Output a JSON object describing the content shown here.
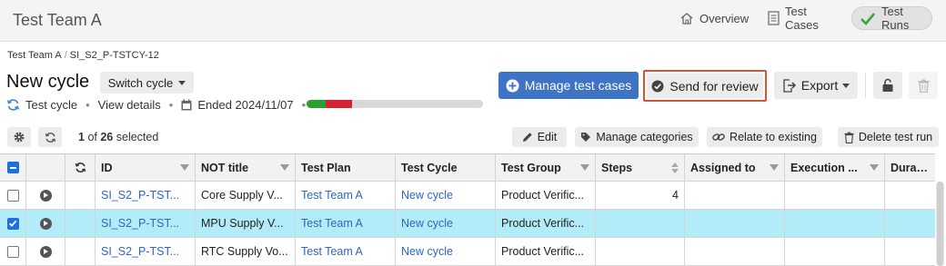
{
  "header": {
    "team_title": "Test Team A",
    "nav": {
      "overview": "Overview",
      "test_cases": "Test Cases",
      "test_runs": "Test Runs"
    }
  },
  "breadcrumb": {
    "team": "Test Team A",
    "separator": "/",
    "cycle_id": "SI_S2_P-TSTCY-12"
  },
  "title": {
    "name": "New cycle",
    "switch_label": "Switch cycle"
  },
  "subline": {
    "type": "Test cycle",
    "view_details": "View details",
    "ended": "Ended 2024/11/07"
  },
  "progress": {
    "segments": [
      {
        "color": "#2ca02c",
        "fraction": 0.11
      },
      {
        "color": "#d62333",
        "fraction": 0.15
      },
      {
        "color": "#d8d8d8",
        "fraction": 0.74
      }
    ]
  },
  "actions": {
    "manage": "Manage test cases",
    "review": "Send for review",
    "export": "Export"
  },
  "toolbar": {
    "selected_count": "1",
    "selected_of": "of",
    "selected_total": "26",
    "selected_suffix": "selected",
    "edit": "Edit",
    "categories": "Manage categories",
    "relate": "Relate to existing",
    "delete": "Delete test run"
  },
  "table": {
    "columns": [
      "ID",
      "NOT title",
      "Test Plan",
      "Test Cycle",
      "Test Group",
      "Steps",
      "Assigned to",
      "Execution ...",
      "Duration"
    ],
    "rows": [
      {
        "id": "SI_S2_P-TST...",
        "title": "Core Supply V...",
        "plan": "Test Team A",
        "cycle": "New cycle",
        "group": "Product Verific...",
        "steps": "4",
        "assigned": "",
        "execution": "",
        "duration": "",
        "selected": false
      },
      {
        "id": "SI_S2_P-TST...",
        "title": "MPU Supply V...",
        "plan": "Test Team A",
        "cycle": "New cycle",
        "group": "Product Verific...",
        "steps": "",
        "assigned": "",
        "execution": "",
        "duration": "",
        "selected": true
      },
      {
        "id": "SI_S2_P-TST...",
        "title": "RTC Supply Vo...",
        "plan": "Test Team A",
        "cycle": "New cycle",
        "group": "Product Verific...",
        "steps": "",
        "assigned": "",
        "execution": "",
        "duration": "",
        "selected": false
      }
    ]
  },
  "colors": {
    "primary": "#3f73c6",
    "highlight": "#d9532f",
    "selected_row": "#b3ecf9",
    "link": "#2f66c0",
    "check_green": "#3aa53a"
  }
}
